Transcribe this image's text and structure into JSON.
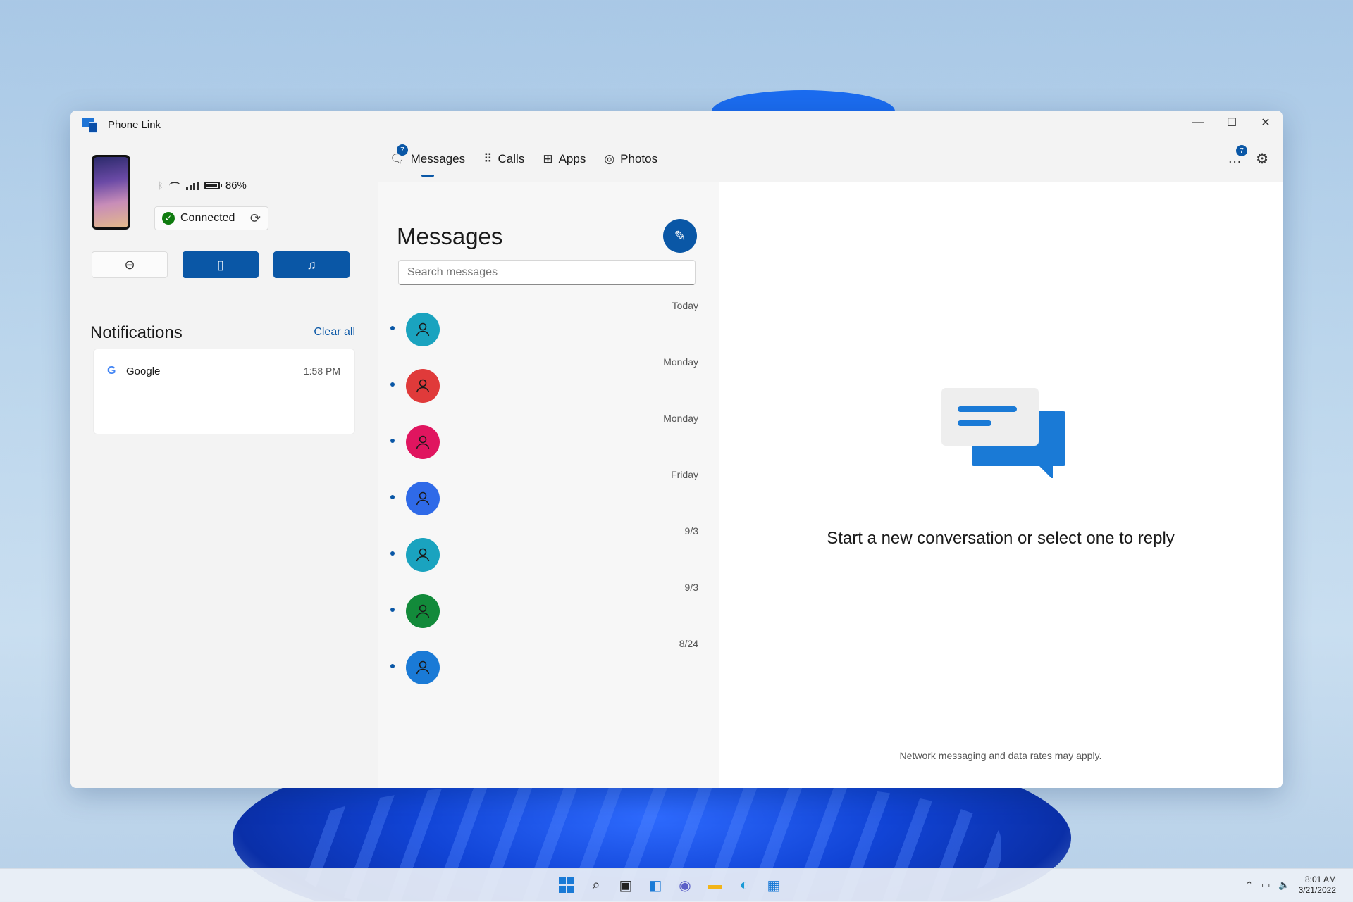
{
  "window": {
    "title": "Phone Link",
    "controls": {
      "minimize": "—",
      "maximize": "☐",
      "close": "✕"
    }
  },
  "device": {
    "battery": "86%",
    "status": "Connected"
  },
  "quick_actions": [
    "do-not-disturb",
    "silent-mode",
    "media-controls"
  ],
  "notifications": {
    "title": "Notifications",
    "clear_all": "Clear all",
    "items": [
      {
        "app": "Google",
        "time": "1:58 PM"
      }
    ]
  },
  "tabs": [
    {
      "label": "Messages",
      "badge": "7",
      "active": true
    },
    {
      "label": "Calls"
    },
    {
      "label": "Apps"
    },
    {
      "label": "Photos"
    }
  ],
  "more_badge": "7",
  "messages": {
    "title": "Messages",
    "search_placeholder": "Search messages",
    "conversations": [
      {
        "date": "Today",
        "color": "#1aa3bf",
        "unread": true
      },
      {
        "date": "Monday",
        "color": "#e03a3a",
        "unread": true
      },
      {
        "date": "Monday",
        "color": "#e0155f",
        "unread": true
      },
      {
        "date": "Friday",
        "color": "#2f6ae8",
        "unread": true
      },
      {
        "date": "9/3",
        "color": "#1aa3bf",
        "unread": true
      },
      {
        "date": "9/3",
        "color": "#128a3a",
        "unread": true
      },
      {
        "date": "8/24",
        "color": "#1a7ad6",
        "unread": true
      }
    ]
  },
  "empty_state": {
    "heading": "Start a new conversation or select one to reply",
    "disclaimer": "Network messaging and data rates may apply."
  },
  "taskbar": {
    "time": "8:01 AM",
    "date": "3/21/2022"
  },
  "colors": {
    "accent": "#0a57a6"
  }
}
